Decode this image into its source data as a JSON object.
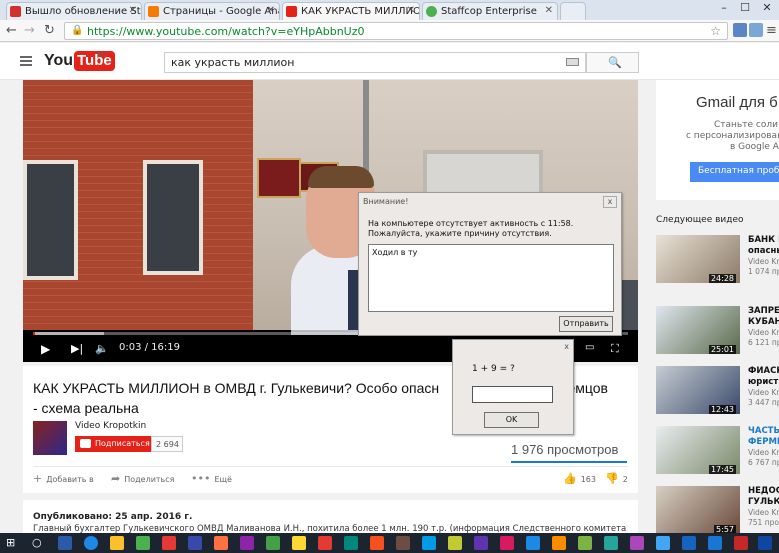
{
  "browser": {
    "tabs": [
      {
        "label": "Вышло обновление Staffc",
        "favicon_color": "#d32f2f"
      },
      {
        "label": "Страницы - Google Analy",
        "favicon_color": "#f57c00"
      },
      {
        "label": "КАК УКРАСТЬ МИЛЛИОН",
        "favicon_color": "#e62117"
      },
      {
        "label": "Staffcop Enterprise",
        "favicon_color": "#4caf50"
      }
    ],
    "url": "https://www.youtube.com/watch?v=eYHpAbbnUz0"
  },
  "youtube": {
    "logo_you": "You",
    "logo_tube": "Tube",
    "logo_region": "RU",
    "search_value": "как украсть миллион"
  },
  "player": {
    "time": "0:03 / 16:19",
    "progress_fraction": 0.003,
    "buffer_fraction": 0.12
  },
  "video": {
    "title": "КАК УКРАСТЬ МИЛЛИОН в ОМВД г. Гулькевичи? Особо опасн",
    "title_end": "Земцов",
    "title_line2": "- схема реальна",
    "channel": "Video Kropotkin",
    "subscribe_label": "Подписаться",
    "subscriber_count": "2 694",
    "views": "1 976 просмотров",
    "actions": {
      "add": "Добавить в",
      "share": "Поделиться",
      "more": "Ещё"
    },
    "likes": "163",
    "dislikes": "2",
    "published": "Опубликовано: 25 апр. 2016 г.",
    "description": "Главный бухгалтер Гулькевичского ОМВД Маливанова И.Н., похитила более 1 млн. 190 т.р. (информация Следственного комитета"
  },
  "sidebar": {
    "ad_title": "Gmail для б",
    "ad_line1": "Станьте соли",
    "ad_line2": "с персонализирован",
    "ad_line3": "в Google Ap",
    "ad_button": "Бесплатная пробная",
    "next_label": "Следующее видео",
    "related": [
      {
        "title": "БАНК Г",
        "title2": "опасны",
        "channel": "Video Kr",
        "views": "1 074 пр",
        "duration": "24:28"
      },
      {
        "title": "ЗАПРЕ",
        "title2": "КУБАН",
        "channel": "Video Kr",
        "views": "6 121 пр",
        "duration": "25:01"
      },
      {
        "title": "ФИАСК",
        "title2": "юрист",
        "channel": "Video Kr",
        "views": "3 447 пр",
        "duration": "12:43"
      },
      {
        "title": "ЧАСТЬ",
        "title2": "ФЕРМЕ",
        "channel": "Video Kr",
        "views": "6 767 пр",
        "duration": "17:45"
      },
      {
        "title": "НЕДОС",
        "title2": "ГУЛЬКЕ",
        "channel": "Video Kr",
        "views": "751 прос",
        "duration": "5:57"
      }
    ]
  },
  "dialog_inactivity": {
    "title": "Внимание!",
    "close": "x",
    "message_line1": "На компьютере отсутствует активность с 11:58.",
    "message_line2": "Пожалуйста, укажите причину отсутствия.",
    "reason_value": "Ходил в ту",
    "send_label": "Отправить"
  },
  "dialog_captcha": {
    "close": "x",
    "question": "1 + 9 = ?",
    "answer_value": "",
    "ok_label": "OK"
  },
  "colors": {
    "youtube_red": "#e62117",
    "link_blue": "#167ac6",
    "ad_button": "#4a8af4"
  }
}
